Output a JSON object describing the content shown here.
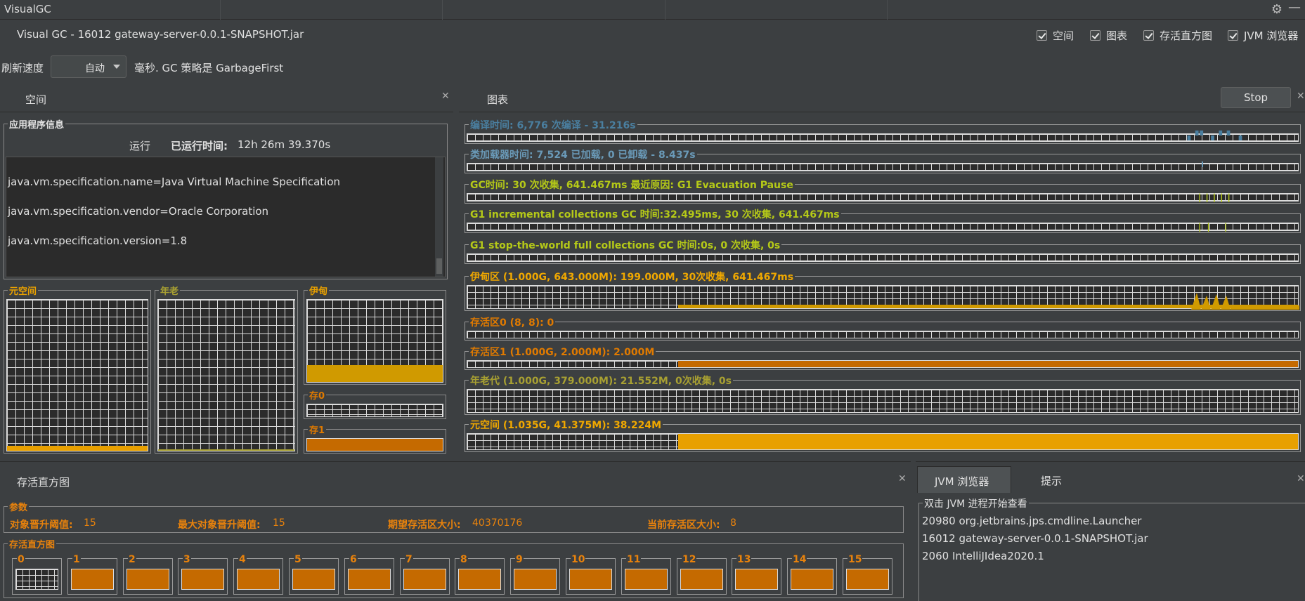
{
  "window": {
    "title": "VisualGC"
  },
  "header": {
    "app_title": "Visual GC - 16012 gateway-server-0.0.1-SNAPSHOT.jar",
    "checkboxes": [
      {
        "label": "空间",
        "checked": true
      },
      {
        "label": "图表",
        "checked": true
      },
      {
        "label": "存活直方图",
        "checked": true
      },
      {
        "label": "JVM 浏览器",
        "checked": true
      }
    ]
  },
  "refresh": {
    "label": "刷新速度",
    "value": "自动",
    "suffix": "毫秒. GC 策略是 GarbageFirst"
  },
  "space_panel": {
    "title": "空间",
    "app_info": {
      "legend": "应用程序信息",
      "status": "运行",
      "uptime_label": "已运行时间:",
      "uptime_value": "12h 26m 39.370s",
      "properties": [
        "java.vm.specification.name=Java Virtual Machine Specification",
        "java.vm.specification.vendor=Oracle Corporation",
        "java.vm.specification.version=1.8"
      ]
    },
    "regions": {
      "metaspace": "元空间",
      "old": "年老",
      "eden": "伊甸",
      "s0": "存0",
      "s1": "存1"
    }
  },
  "graph_panel": {
    "title": "图表",
    "stop_label": "Stop",
    "rows": [
      {
        "label": "编译时间: 6,776 次编译 - 31.216s",
        "color": "#4a7fa0"
      },
      {
        "label": "类加载器时间: 7,524 已加载, 0 已卸载 - 8.437s",
        "color": "#6a9ab8"
      },
      {
        "label": "GC时间: 30 次收集, 641.467ms 最近原因: G1 Evacuation Pause",
        "color": "#b5c918"
      },
      {
        "label": "G1 incremental collections GC 时间:32.495ms, 30 次收集, 641.467ms",
        "color": "#b5c918"
      },
      {
        "label": "G1 stop-the-world full collections GC 时间:0s, 0 次收集, 0s",
        "color": "#b5c918"
      },
      {
        "label": "伊甸区 (1.000G, 643.000M): 199.000M, 30次收集, 641.467ms",
        "color": "#f0a800"
      },
      {
        "label": "存活区0 (8, 8): 0",
        "color": "#e07a00"
      },
      {
        "label": "存活区1 (1.000G, 2.000M): 2.000M",
        "color": "#e07a00"
      },
      {
        "label": "年老代 (1.000G, 379.000M): 21.552M, 0次收集, 0s",
        "color": "#a8a032"
      },
      {
        "label": "元空间 (1.035G, 41.375M): 38.224M",
        "color": "#f0a800"
      }
    ]
  },
  "histogram_panel": {
    "title": "存活直方图",
    "params_legend": "参数",
    "params": [
      {
        "label": "对象晋升阈值:",
        "value": "15"
      },
      {
        "label": "最大对象晋升阈值:",
        "value": "15"
      },
      {
        "label": "期望存活区大小:",
        "value": "40370176"
      },
      {
        "label": "当前存活区大小:",
        "value": "8"
      }
    ],
    "hist_legend": "存活直方图",
    "buckets": [
      "0",
      "1",
      "2",
      "3",
      "4",
      "5",
      "6",
      "7",
      "8",
      "9",
      "10",
      "11",
      "12",
      "13",
      "14",
      "15"
    ]
  },
  "jvm_panel": {
    "tabs": [
      "JVM 浏览器",
      "提示"
    ],
    "legend": "双击 JVM 进程开始查看",
    "processes": [
      "20980 org.jetbrains.jps.cmdline.Launcher",
      "16012 gateway-server-0.0.1-SNAPSHOT.jar",
      "2060 IntelliJIdea2020.1"
    ]
  },
  "colors": {
    "eden": "#d09a00",
    "survivor": "#c56a00",
    "metaspace": "#e8a000",
    "old": "#a8a032"
  }
}
